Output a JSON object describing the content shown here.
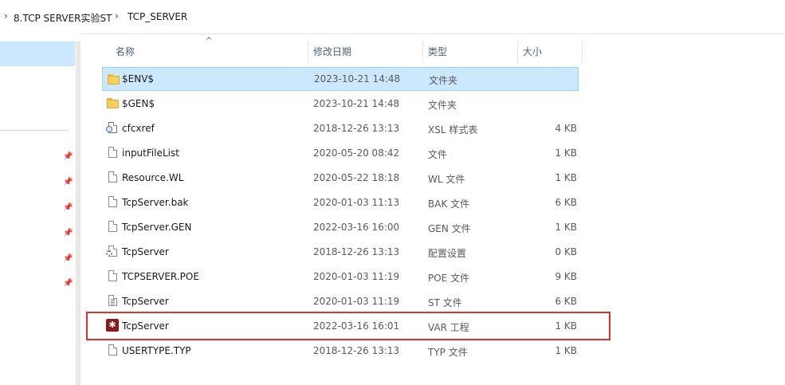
{
  "breadcrumb": {
    "items": [
      "8.TCP SERVER实验ST",
      "TCP_SERVER"
    ]
  },
  "columns": {
    "name": "名称",
    "date": "修改日期",
    "type": "类型",
    "size": "大小"
  },
  "files": [
    {
      "name": "$ENV$",
      "date": "2023-10-21 14:48",
      "type": "文件夹",
      "size": "",
      "icon": "folder-icon",
      "selected": true
    },
    {
      "name": "$GEN$",
      "date": "2023-10-21 14:48",
      "type": "文件夹",
      "size": "",
      "icon": "folder-icon"
    },
    {
      "name": "cfcxref",
      "date": "2018-12-26 13:13",
      "type": "XSL 样式表",
      "size": "4 KB",
      "icon": "xsl-file-icon"
    },
    {
      "name": "inputFileList",
      "date": "2020-05-20 08:42",
      "type": "文件",
      "size": "1 KB",
      "icon": "file-icon"
    },
    {
      "name": "Resource.WL",
      "date": "2020-05-22 18:18",
      "type": "WL 文件",
      "size": "1 KB",
      "icon": "file-icon"
    },
    {
      "name": "TcpServer.bak",
      "date": "2020-01-03 11:13",
      "type": "BAK 文件",
      "size": "6 KB",
      "icon": "file-icon"
    },
    {
      "name": "TcpServer.GEN",
      "date": "2022-03-16 16:00",
      "type": "GEN 文件",
      "size": "1 KB",
      "icon": "file-icon"
    },
    {
      "name": "TcpServer",
      "date": "2018-12-26 13:13",
      "type": "配置设置",
      "size": "0 KB",
      "icon": "config-file-icon"
    },
    {
      "name": "TCPSERVER.POE",
      "date": "2020-01-03 11:19",
      "type": "POE 文件",
      "size": "9 KB",
      "icon": "file-icon"
    },
    {
      "name": "TcpServer",
      "date": "2020-01-03 11:19",
      "type": "ST 文件",
      "size": "6 KB",
      "icon": "text-file-icon"
    },
    {
      "name": "TcpServer",
      "date": "2022-03-16 16:01",
      "type": "VAR 工程",
      "size": "1 KB",
      "icon": "var-project-icon"
    },
    {
      "name": "USERTYPE.TYP",
      "date": "2018-12-26 13:13",
      "type": "TYP 文件",
      "size": "1 KB",
      "icon": "file-icon"
    }
  ],
  "colors": {
    "selection": "#cce8ff",
    "selection_border": "#99d1ff",
    "highlight_box": "#e0302e",
    "header_text": "#4c607a"
  }
}
